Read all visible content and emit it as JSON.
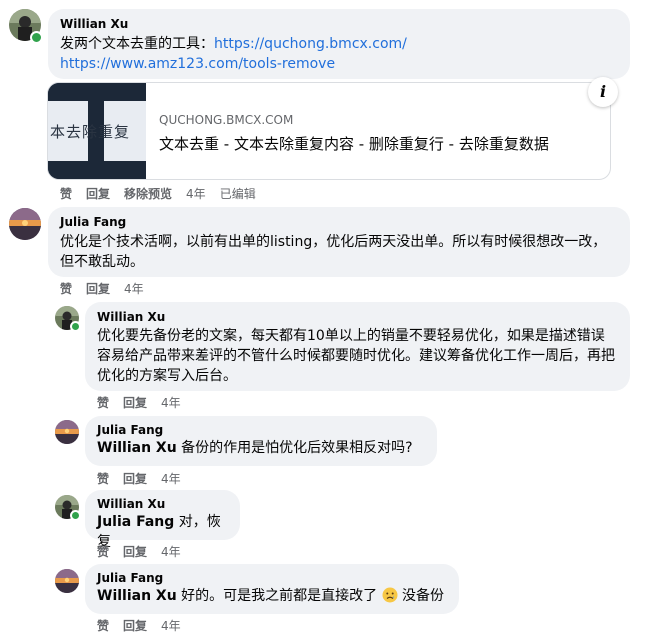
{
  "comments": [
    {
      "author": "Willian Xu",
      "text_prefix": "发两个文本去重的工具：",
      "link1": "https://quchong.bmcx.com/",
      "link2": "https://www.amz123.com/tools-remove",
      "card": {
        "domain": "QUCHONG.BMCX.COM",
        "title": "文本去重 - 文本去除重复内容 - 删除重复行 - 去除重复数据",
        "thumb_text": "本去除重复"
      },
      "actions": {
        "like": "赞",
        "reply": "回复",
        "remove_preview": "移除预览",
        "time": "4年",
        "edited": "已编辑"
      }
    },
    {
      "author": "Julia Fang",
      "text": "优化是个技术活啊，以前有出单的listing，优化后两天没出单。所以有时候很想改一改，但不敢乱动。",
      "actions": {
        "like": "赞",
        "reply": "回复",
        "time": "4年"
      }
    },
    {
      "author": "Willian Xu",
      "text": "优化要先备份老的文案，每天都有10单以上的销量不要轻易优化，如果是描述错误容易给产品带来差评的不管什么时候都要随时优化。建议筹备优化工作一周后，再把优化的方案写入后台。",
      "actions": {
        "like": "赞",
        "reply": "回复",
        "time": "4年"
      }
    },
    {
      "author": "Julia Fang",
      "mention": "Willian Xu",
      "text": " 备份的作用是怕优化后效果相反对吗?",
      "actions": {
        "like": "赞",
        "reply": "回复",
        "time": "4年"
      }
    },
    {
      "author": "Willian Xu",
      "mention": "Julia Fang",
      "text": " 对，恢复",
      "actions": {
        "like": "赞",
        "reply": "回复",
        "time": "4年"
      }
    },
    {
      "author": "Julia Fang",
      "mention": "Willian Xu",
      "text": " 好的。可是我之前都是直接改了",
      "emoji": "sad-face-emoji",
      "text_after": " 没备份",
      "actions": {
        "like": "赞",
        "reply": "回复",
        "time": "4年"
      }
    }
  ],
  "colors": {
    "link": "#216fdb",
    "bubble": "#f0f2f5",
    "online": "#31a24c",
    "meta": "#65676b"
  }
}
